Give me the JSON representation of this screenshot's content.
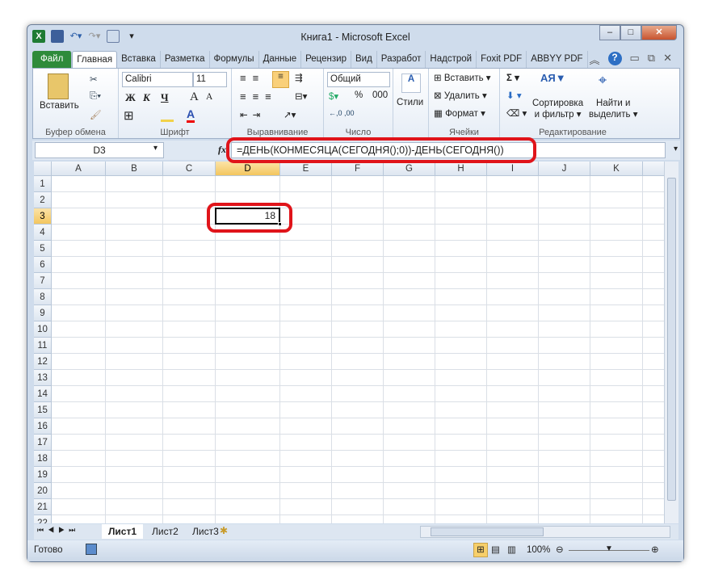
{
  "window": {
    "title": "Книга1  -  Microsoft Excel"
  },
  "tabs": [
    "Файл",
    "Главная",
    "Вставка",
    "Разметка",
    "Формулы",
    "Данные",
    "Рецензир",
    "Вид",
    "Разработ",
    "Надстрой",
    "Foxit PDF",
    "ABBYY PDF"
  ],
  "ribbon": {
    "clipboard": {
      "label": "Буфер обмена",
      "paste": "Вставить"
    },
    "font": {
      "label": "Шрифт",
      "name": "Calibri",
      "size": "11",
      "bold": "Ж",
      "italic": "К",
      "underline": "Ч"
    },
    "align": {
      "label": "Выравнивание"
    },
    "number": {
      "label": "Число",
      "format": "Общий",
      "percent": "%",
      "thousands": "000"
    },
    "styles": {
      "label": "Стили"
    },
    "cells": {
      "label": "Ячейки",
      "insert": "Вставить",
      "delete": "Удалить",
      "format": "Формат"
    },
    "editing": {
      "label": "Редактирование",
      "sort1": "Сортировка",
      "sort2": "и фильтр",
      "find1": "Найти и",
      "find2": "выделить"
    }
  },
  "formula_bar": {
    "name_box": "D3",
    "fx": "fx",
    "formula": "=ДЕНЬ(КОНМЕСЯЦА(СЕГОДНЯ();0))-ДЕНЬ(СЕГОДНЯ())"
  },
  "grid": {
    "columns": [
      "A",
      "B",
      "C",
      "D",
      "E",
      "F",
      "G",
      "H",
      "I",
      "J",
      "K"
    ],
    "row_count": 22,
    "selected": "D3",
    "cells": {
      "D3": "18"
    }
  },
  "sheets": [
    "Лист1",
    "Лист2",
    "Лист3"
  ],
  "status": {
    "ready": "Готово",
    "zoom": "100%"
  },
  "colors": {
    "accent_red": "#e0141a",
    "file_tab": "#2e8b3a",
    "selection": "#f3c65e"
  }
}
